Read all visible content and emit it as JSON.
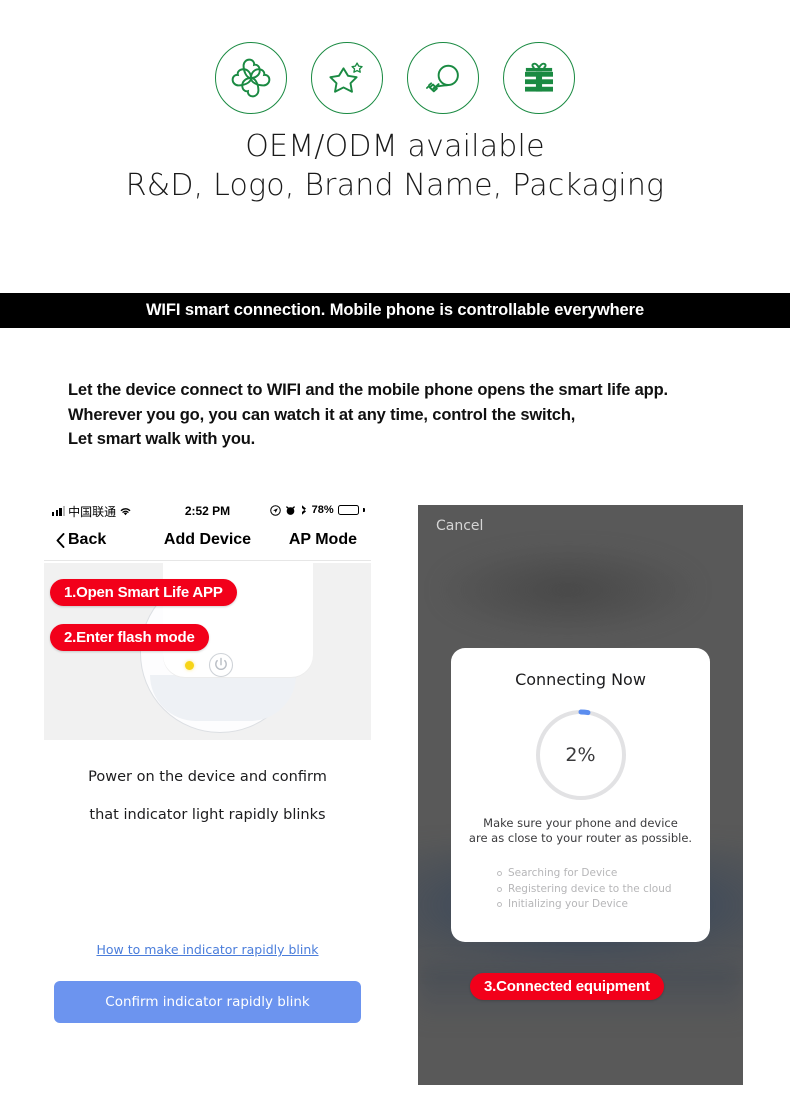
{
  "feature_icons": [
    {
      "name": "clover-icon",
      "label": "four-leaf-clover"
    },
    {
      "name": "star-icon",
      "label": "star"
    },
    {
      "name": "plug-cable-icon",
      "label": "power-plug-cable"
    },
    {
      "name": "gift-icon",
      "label": "gift-box"
    }
  ],
  "headline": {
    "line1": "OEM/ODM available",
    "line2": "R&D, Logo, Brand Name, Packaging"
  },
  "banner": {
    "text": "WIFI smart connection. Mobile phone is controllable everywhere",
    "bg": "#000000",
    "fg": "#ffffff"
  },
  "paragraph": {
    "line1": "Let the device connect to WIFI and the mobile phone opens the smart life app.",
    "line2": "Wherever you go, you can watch it at any time, control the switch,",
    "line3": "Let smart walk with you."
  },
  "callouts": {
    "step1": "1.Open Smart Life APP",
    "step2": "2.Enter flash mode",
    "step3": "3.Connected equipment",
    "color": "#f2001a"
  },
  "left_phone": {
    "statusbar": {
      "carrier": "中国联通",
      "time": "2:52 PM",
      "battery_percent": "78%",
      "signal_icon": "cellular-signal-icon",
      "wifi_icon": "wifi-icon",
      "location_icon": "location-arrow-icon",
      "alarm_icon": "alarm-clock-icon",
      "bluetooth_icon": "bluetooth-icon",
      "battery_icon": "battery-icon"
    },
    "navbar": {
      "back_label": "Back",
      "back_icon": "chevron-left-icon",
      "title": "Add Device",
      "right_action": "AP Mode"
    },
    "device_illustration": {
      "led_color": "#f7d417",
      "power_icon": "power-button-icon"
    },
    "caption_line1": "Power on the device and confirm",
    "caption_line2": "that indicator light rapidly blinks",
    "help_link": "How to make indicator rapidly blink",
    "confirm_button": "Confirm indicator rapidly blink",
    "confirm_button_color": "#6c94ef",
    "link_color": "#4a7ddb"
  },
  "right_phone": {
    "cancel_label": "Cancel",
    "modal_title": "Connecting Now",
    "progress_percent": "2%",
    "progress_value": 2,
    "progress_track_color": "#e2e2e4",
    "progress_accent_color": "#5b8def",
    "hint_line1": "Make sure your phone and device",
    "hint_line2": "are as close to your router as possible.",
    "steps": [
      "Searching for Device",
      "Registering device to the cloud",
      "Initializing your Device"
    ],
    "overlay_color": "#595959"
  }
}
